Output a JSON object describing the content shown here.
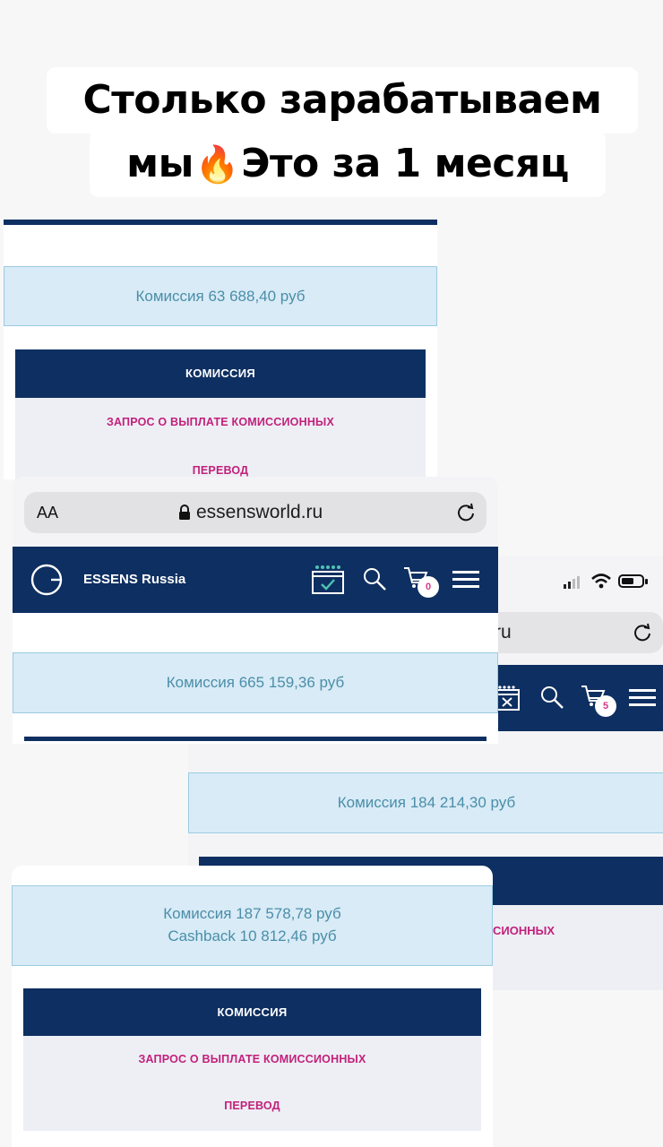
{
  "caption": {
    "line1": "Столько зарабатываем",
    "line2_start": "мы",
    "line2_emoji": "🔥",
    "line2_end": "Это за 1 месяц"
  },
  "shot1": {
    "commission": "Комиссия 63 688,40 руб",
    "menu_title": "КОМИССИЯ",
    "menu_request": "ЗАПРОС О ВЫПЛАТЕ КОМИССИОННЫХ",
    "menu_transfer": "ПЕРЕВОД"
  },
  "shot2": {
    "text_size_label": "AA",
    "url": "essensworld.ru",
    "brand": "ESSENS Russia",
    "cart_count": "0",
    "commission": "Комиссия 665 159,36 руб"
  },
  "shot3": {
    "url_fragment": "ru",
    "cart_count": "5",
    "commission": "Комиссия 184 214,30 руб",
    "menu_request_fragment": "СИОННЫХ"
  },
  "shot4": {
    "commission": "Комиссия 187 578,78 руб",
    "cashback": "Cashback 10 812,46 руб",
    "menu_title": "КОМИССИЯ",
    "menu_request": "ЗАПРОС О ВЫПЛАТЕ КОМИССИОННЫХ",
    "menu_transfer": "ПЕРЕВОД"
  },
  "colors": {
    "navy": "#0e2f61",
    "light_blue": "#d8ebf6",
    "teal_text": "#4b8ea9",
    "magenta": "#c3207a",
    "badge_pink": "#d33a8a"
  }
}
